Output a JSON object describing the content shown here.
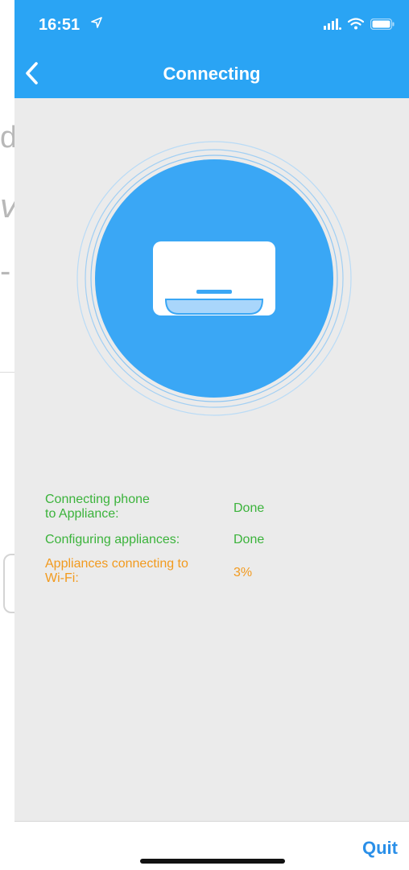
{
  "status_bar": {
    "time": "16:51",
    "location_icon": "location-arrow-icon",
    "signal_icon": "signal-icon",
    "wifi_icon": "wifi-icon",
    "battery_icon": "battery-icon"
  },
  "nav": {
    "title": "Connecting",
    "back_icon": "chevron-left-icon"
  },
  "hero": {
    "icon": "air-conditioner-icon",
    "circle_color": "#3aa7f5"
  },
  "steps": [
    {
      "label_line1": "Connecting phone",
      "label_line2": "to Appliance:",
      "value": "Done",
      "state": "done"
    },
    {
      "label_line1": "Configuring appliances:",
      "label_line2": "",
      "value": "Done",
      "state": "done"
    },
    {
      "label_line1": "Appliances connecting to",
      "label_line2": "Wi-Fi:",
      "value": "3%",
      "state": "in-progress"
    }
  ],
  "footer": {
    "quit_label": "Quit"
  },
  "background_fragments": [
    "d",
    "v",
    "-"
  ],
  "colors": {
    "accent": "#2aa4f4",
    "done": "#3bb33b",
    "progress": "#f29a1e",
    "quit": "#2a8fe8"
  }
}
